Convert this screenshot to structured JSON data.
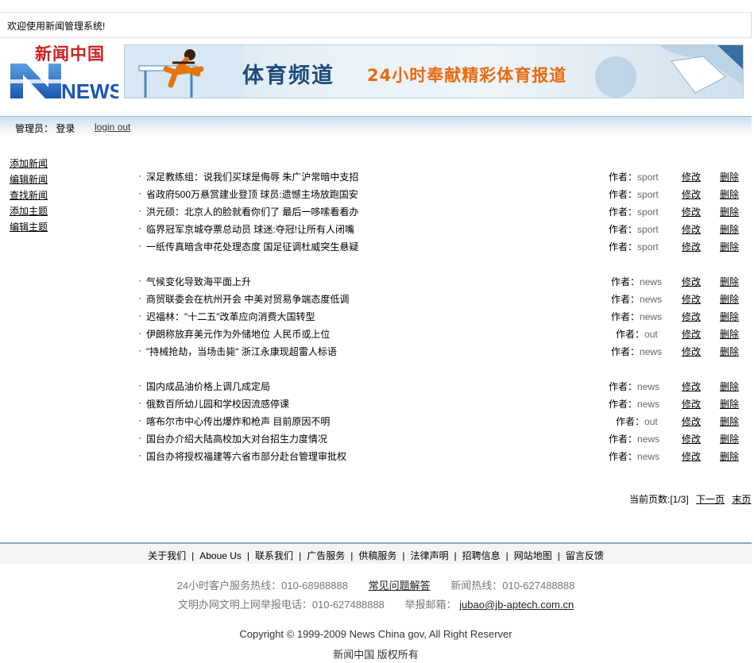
{
  "welcome": "欢迎使用新闻管理系统!",
  "logo": {
    "cn": "新闻中国",
    "en": "NEWS"
  },
  "banner": {
    "title": "体育频道",
    "slogan": "24小时奉献精彩体育报道"
  },
  "admin": {
    "label": "管理员： 登录",
    "logout": "login out"
  },
  "sidebar": [
    "添加新闻",
    "编辑新闻",
    "查找新闻",
    "添加主题",
    "编辑主题"
  ],
  "author_label": "作者：",
  "actions": {
    "edit": "修改",
    "delete": "删除"
  },
  "groups": [
    [
      {
        "title": "深足教练组：说我们买球是侮辱 朱广沪常暗中支招",
        "author": "sport"
      },
      {
        "title": "省政府500万悬赏建业登顶 球员:遗憾主场放跑国安",
        "author": "sport"
      },
      {
        "title": "洪元硕：北京人的脸就看你们了 最后一哆嗦看看办",
        "author": "sport"
      },
      {
        "title": "临界冠军京城夺票总动员 球迷:夺冠!让所有人闭嘴",
        "author": "sport"
      },
      {
        "title": "一纸传真暗含申花处理态度 国足征调杜威突生悬疑",
        "author": "sport"
      }
    ],
    [
      {
        "title": "气候变化导致海平面上升",
        "author": "news"
      },
      {
        "title": "商贸联委会在杭州开会 中美对贸易争端态度低调",
        "author": "news"
      },
      {
        "title": "迟福林：\"十二五\"改革应向消费大国转型",
        "author": "news"
      },
      {
        "title": "伊朗称放弃美元作为外储地位 人民币或上位",
        "author": "out"
      },
      {
        "title": "\"持械抢劫，当场击毙\" 浙江永康现超雷人标语",
        "author": "news"
      }
    ],
    [
      {
        "title": "国内成品油价格上调几成定局",
        "author": "news"
      },
      {
        "title": "俄数百所幼儿园和学校因流感停课",
        "author": "news"
      },
      {
        "title": "喀布尔市中心传出爆炸和枪声 目前原因不明",
        "author": "out"
      },
      {
        "title": "国台办介绍大陆高校加大对台招生力度情况",
        "author": "news"
      },
      {
        "title": "国台办将授权福建等六省市部分赴台管理审批权",
        "author": "news"
      }
    ]
  ],
  "pager": {
    "current": "当前页数:[1/3]",
    "next": "下一页",
    "last": "末页"
  },
  "footer_nav": [
    "关于我们",
    "Aboue Us",
    "联系我们",
    "广告服务",
    "供稿服务",
    "法律声明",
    "招聘信息",
    "网站地图",
    "留言反馈"
  ],
  "footer": {
    "hotline": "24小时客户服务热线：010-68988888",
    "faq": "常见问题解答",
    "news_hotline": "新闻热线：010-627488888",
    "report_phone": "文明办网文明上网举报电话：010-627488888",
    "report_email_label": "举报邮箱：",
    "report_email": "jubao@jb-aptech.com.cn",
    "copyright": "Copyright © 1999-2009 News China gov, All Right Reserver",
    "rights": "新闻中国 版权所有"
  }
}
